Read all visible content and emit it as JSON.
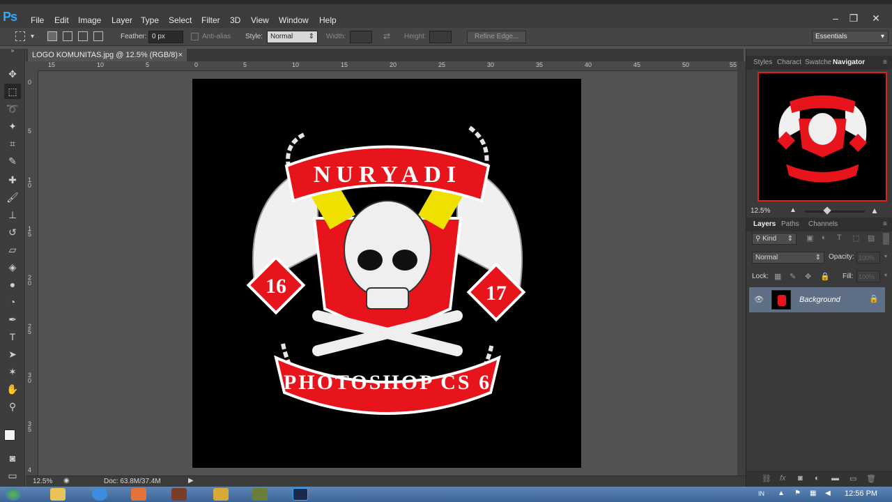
{
  "app": {
    "logo": "Ps"
  },
  "menu": [
    "File",
    "Edit",
    "Image",
    "Layer",
    "Type",
    "Select",
    "Filter",
    "3D",
    "View",
    "Window",
    "Help"
  ],
  "options": {
    "feather_label": "Feather:",
    "feather_value": "0 px",
    "antialias_label": "Anti-alias",
    "style_label": "Style:",
    "style_value": "Normal",
    "width_label": "Width:",
    "height_label": "Height:",
    "refine_label": "Refine Edge...",
    "workspace": "Essentials"
  },
  "document": {
    "tab_title": "LOGO KOMUNITAS.jpg @ 12.5% (RGB/8)",
    "tab_close": "×",
    "ruler_top": [
      "15",
      "10",
      "5",
      "0",
      "5",
      "10",
      "15",
      "20",
      "25",
      "30",
      "35",
      "40",
      "45",
      "50",
      "55"
    ],
    "ruler_left": [
      "0",
      "5",
      "1\n0",
      "1\n5",
      "2\n0",
      "2\n5",
      "3\n0",
      "3\n5",
      "4"
    ],
    "zoom": "12.5%",
    "doc_size": "Doc: 63.8M/37.4M"
  },
  "artwork": {
    "top_banner": "NURYADI",
    "bottom_banner": "PHOTOSHOP CS 6",
    "left_badge": "16",
    "right_badge": "17",
    "colors": {
      "red": "#e8141b",
      "yellow": "#f0e000",
      "white": "#f2f2f2"
    }
  },
  "panels": {
    "top_tabs": [
      "Styles",
      "Charact",
      "Swatche",
      "Navigator"
    ],
    "nav_zoom": "12.5%",
    "layer_tabs": [
      "Layers",
      "Paths",
      "Channels"
    ],
    "kind_label": "Kind",
    "blend_mode": "Normal",
    "opacity_label": "Opacity:",
    "opacity_value": "100%",
    "lock_label": "Lock:",
    "fill_label": "Fill:",
    "fill_value": "100%",
    "layer_name": "Background"
  },
  "taskbar": {
    "time": "12:56 PM",
    "lang": "IN"
  }
}
